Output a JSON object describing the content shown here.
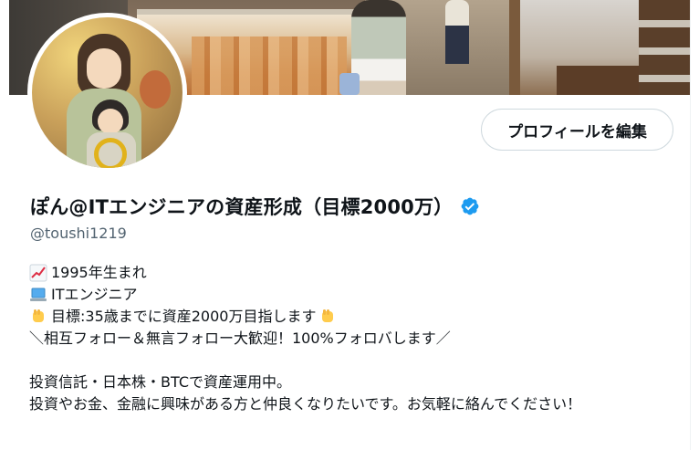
{
  "header": {
    "edit_profile_label": "プロフィールを編集"
  },
  "profile": {
    "display_name": "ぽん@ITエンジニアの資産形成（目標2000万）",
    "handle": "@toushi1219",
    "verified": true,
    "accent_color": "#1d9bf0"
  },
  "bio": {
    "line1_icon": "chart-increasing-emoji",
    "line1": "1995年生まれ",
    "line2_icon": "laptop-emoji",
    "line2": "ITエンジニア",
    "line3_icon": "raised-fist-emoji",
    "line3": "目標:35歳までに資産2000万目指します",
    "line4": "＼相互フォロー＆無言フォロー大歓迎！100%フォロバします／",
    "line5": "投資信託・日本株・BTCで資産運用中。",
    "line6": "投資やお金、金融に興味がある方と仲良くなりたいです。お気軽に絡んでください！"
  }
}
